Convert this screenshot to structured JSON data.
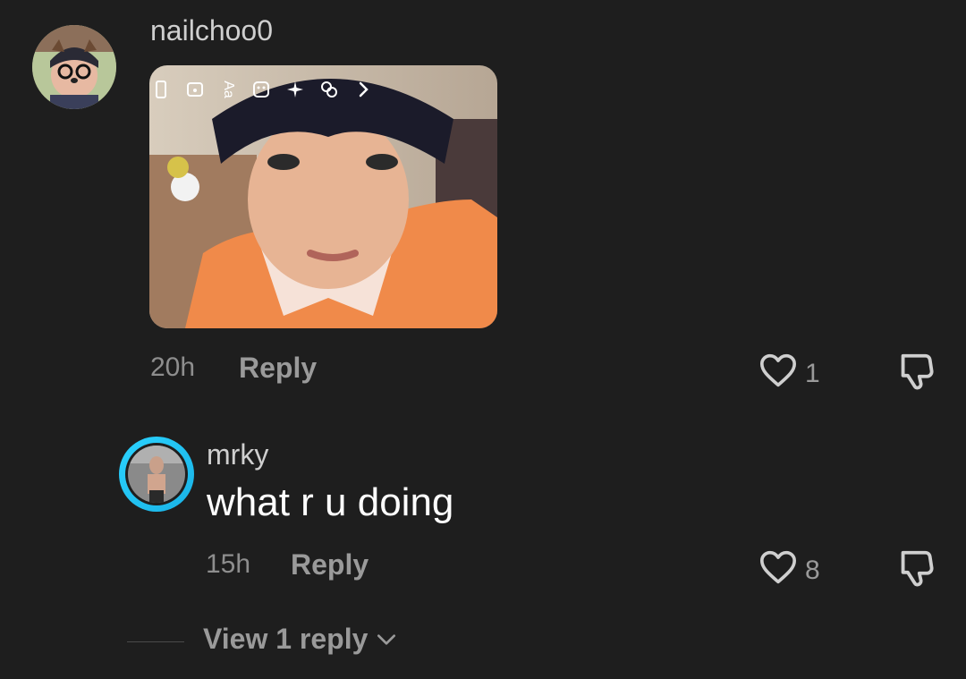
{
  "comments": [
    {
      "username": "nailchoo0",
      "time": "20h",
      "reply_label": "Reply",
      "likes": "1"
    },
    {
      "username": "mrky",
      "text": "what r u doing",
      "time": "15h",
      "reply_label": "Reply",
      "likes": "8"
    }
  ],
  "photo_toolbar_text": "Aa",
  "view_replies_label": "View 1 reply",
  "colors": {
    "background": "#1e1e1e",
    "muted_text": "#9a9a9a",
    "avatar_ring": "#2bd3ff"
  },
  "icons": [
    "heart-icon",
    "dislike-icon",
    "chevron-down-icon",
    "phone-icon",
    "sticker-icon",
    "sparkle-icon",
    "effects-icon",
    "chevron-right-icon"
  ]
}
